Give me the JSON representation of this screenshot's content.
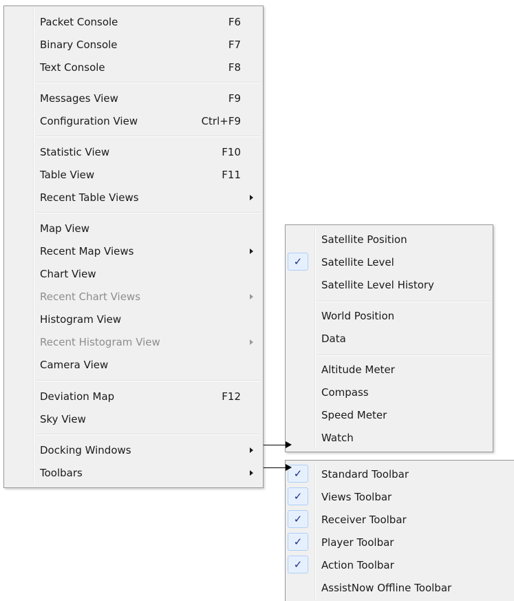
{
  "main_menu": {
    "items": [
      {
        "label": "Packet Console",
        "shortcut": "F6"
      },
      {
        "label": "Binary Console",
        "shortcut": "F7"
      },
      {
        "label": "Text Console",
        "shortcut": "F8"
      },
      {
        "label": "Messages View",
        "shortcut": "F9"
      },
      {
        "label": "Configuration View",
        "shortcut": "Ctrl+F9"
      },
      {
        "label": "Statistic View",
        "shortcut": "F10"
      },
      {
        "label": "Table View",
        "shortcut": "F11"
      },
      {
        "label": "Recent Table Views",
        "submenu": true
      },
      {
        "label": "Map View"
      },
      {
        "label": "Recent Map Views",
        "submenu": true
      },
      {
        "label": "Chart View"
      },
      {
        "label": "Recent Chart Views",
        "submenu": true,
        "disabled": true
      },
      {
        "label": "Histogram View"
      },
      {
        "label": "Recent Histogram View",
        "submenu": true,
        "disabled": true
      },
      {
        "label": "Camera View"
      },
      {
        "label": "Deviation Map",
        "shortcut": "F12"
      },
      {
        "label": "Sky View"
      },
      {
        "label": "Docking Windows",
        "submenu": true
      },
      {
        "label": "Toolbars",
        "submenu": true
      }
    ]
  },
  "docking_windows_menu": {
    "items": [
      {
        "label": "Satellite Position",
        "checked": false
      },
      {
        "label": "Satellite Level",
        "checked": true
      },
      {
        "label": "Satellite Level History",
        "checked": false
      },
      {
        "label": "World Position",
        "checked": false
      },
      {
        "label": "Data",
        "checked": false
      },
      {
        "label": "Altitude Meter",
        "checked": false
      },
      {
        "label": "Compass",
        "checked": false
      },
      {
        "label": "Speed Meter",
        "checked": false
      },
      {
        "label": "Watch",
        "checked": false
      }
    ]
  },
  "toolbars_menu": {
    "items": [
      {
        "label": "Standard Toolbar",
        "checked": true
      },
      {
        "label": "Views Toolbar",
        "checked": true
      },
      {
        "label": "Receiver Toolbar",
        "checked": true
      },
      {
        "label": "Player Toolbar",
        "checked": true
      },
      {
        "label": "Action Toolbar",
        "checked": true
      },
      {
        "label": "AssistNow Offline Toolbar",
        "checked": false
      }
    ]
  },
  "glyphs": {
    "checkmark": "✓"
  },
  "colors": {
    "menu_background": "#f0f0f0",
    "menu_border": "#979797",
    "check_highlight": "#e6f0fd",
    "check_border": "#aecff7",
    "disabled_text": "#8d8d8d"
  }
}
